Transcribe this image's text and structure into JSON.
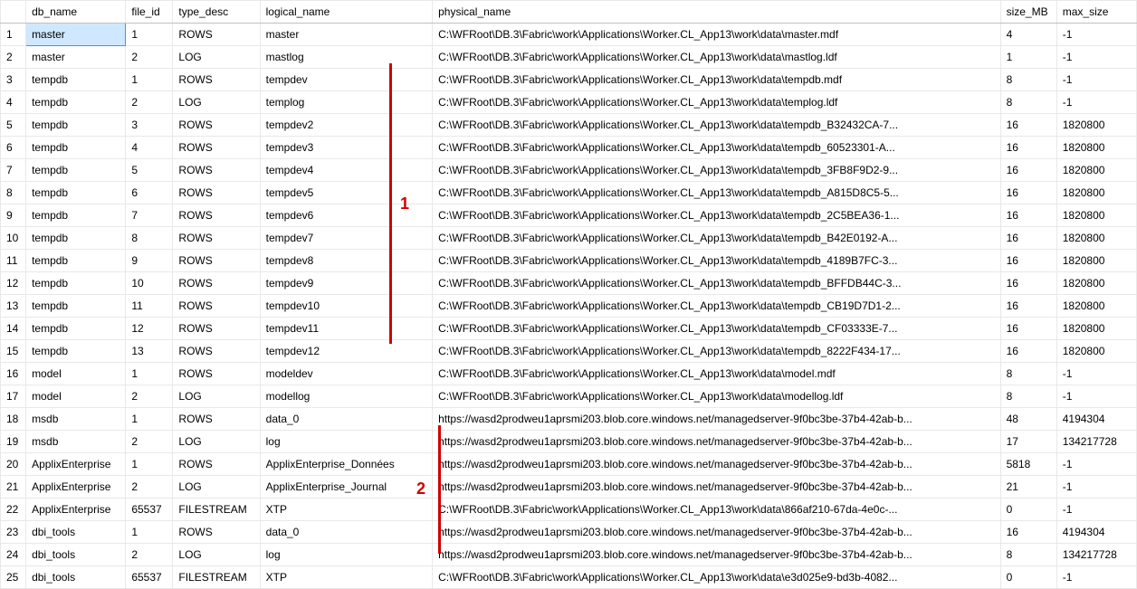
{
  "columns": [
    "db_name",
    "file_id",
    "type_desc",
    "logical_name",
    "physical_name",
    "size_MB",
    "max_size"
  ],
  "rows": [
    {
      "n": 1,
      "db_name": "master",
      "file_id": "1",
      "type_desc": "ROWS",
      "logical_name": "master",
      "physical_name": "C:\\WFRoot\\DB.3\\Fabric\\work\\Applications\\Worker.CL_App13\\work\\data\\master.mdf",
      "size_MB": "4",
      "max_size": "-1"
    },
    {
      "n": 2,
      "db_name": "master",
      "file_id": "2",
      "type_desc": "LOG",
      "logical_name": "mastlog",
      "physical_name": "C:\\WFRoot\\DB.3\\Fabric\\work\\Applications\\Worker.CL_App13\\work\\data\\mastlog.ldf",
      "size_MB": "1",
      "max_size": "-1"
    },
    {
      "n": 3,
      "db_name": "tempdb",
      "file_id": "1",
      "type_desc": "ROWS",
      "logical_name": "tempdev",
      "physical_name": "C:\\WFRoot\\DB.3\\Fabric\\work\\Applications\\Worker.CL_App13\\work\\data\\tempdb.mdf",
      "size_MB": "8",
      "max_size": "-1"
    },
    {
      "n": 4,
      "db_name": "tempdb",
      "file_id": "2",
      "type_desc": "LOG",
      "logical_name": "templog",
      "physical_name": "C:\\WFRoot\\DB.3\\Fabric\\work\\Applications\\Worker.CL_App13\\work\\data\\templog.ldf",
      "size_MB": "8",
      "max_size": "-1"
    },
    {
      "n": 5,
      "db_name": "tempdb",
      "file_id": "3",
      "type_desc": "ROWS",
      "logical_name": "tempdev2",
      "physical_name": "C:\\WFRoot\\DB.3\\Fabric\\work\\Applications\\Worker.CL_App13\\work\\data\\tempdb_B32432CA-7...",
      "size_MB": "16",
      "max_size": "1820800"
    },
    {
      "n": 6,
      "db_name": "tempdb",
      "file_id": "4",
      "type_desc": "ROWS",
      "logical_name": "tempdev3",
      "physical_name": "C:\\WFRoot\\DB.3\\Fabric\\work\\Applications\\Worker.CL_App13\\work\\data\\tempdb_60523301-A...",
      "size_MB": "16",
      "max_size": "1820800"
    },
    {
      "n": 7,
      "db_name": "tempdb",
      "file_id": "5",
      "type_desc": "ROWS",
      "logical_name": "tempdev4",
      "physical_name": "C:\\WFRoot\\DB.3\\Fabric\\work\\Applications\\Worker.CL_App13\\work\\data\\tempdb_3FB8F9D2-9...",
      "size_MB": "16",
      "max_size": "1820800"
    },
    {
      "n": 8,
      "db_name": "tempdb",
      "file_id": "6",
      "type_desc": "ROWS",
      "logical_name": "tempdev5",
      "physical_name": "C:\\WFRoot\\DB.3\\Fabric\\work\\Applications\\Worker.CL_App13\\work\\data\\tempdb_A815D8C5-5...",
      "size_MB": "16",
      "max_size": "1820800"
    },
    {
      "n": 9,
      "db_name": "tempdb",
      "file_id": "7",
      "type_desc": "ROWS",
      "logical_name": "tempdev6",
      "physical_name": "C:\\WFRoot\\DB.3\\Fabric\\work\\Applications\\Worker.CL_App13\\work\\data\\tempdb_2C5BEA36-1...",
      "size_MB": "16",
      "max_size": "1820800"
    },
    {
      "n": 10,
      "db_name": "tempdb",
      "file_id": "8",
      "type_desc": "ROWS",
      "logical_name": "tempdev7",
      "physical_name": "C:\\WFRoot\\DB.3\\Fabric\\work\\Applications\\Worker.CL_App13\\work\\data\\tempdb_B42E0192-A...",
      "size_MB": "16",
      "max_size": "1820800"
    },
    {
      "n": 11,
      "db_name": "tempdb",
      "file_id": "9",
      "type_desc": "ROWS",
      "logical_name": "tempdev8",
      "physical_name": "C:\\WFRoot\\DB.3\\Fabric\\work\\Applications\\Worker.CL_App13\\work\\data\\tempdb_4189B7FC-3...",
      "size_MB": "16",
      "max_size": "1820800"
    },
    {
      "n": 12,
      "db_name": "tempdb",
      "file_id": "10",
      "type_desc": "ROWS",
      "logical_name": "tempdev9",
      "physical_name": "C:\\WFRoot\\DB.3\\Fabric\\work\\Applications\\Worker.CL_App13\\work\\data\\tempdb_BFFDB44C-3...",
      "size_MB": "16",
      "max_size": "1820800"
    },
    {
      "n": 13,
      "db_name": "tempdb",
      "file_id": "11",
      "type_desc": "ROWS",
      "logical_name": "tempdev10",
      "physical_name": "C:\\WFRoot\\DB.3\\Fabric\\work\\Applications\\Worker.CL_App13\\work\\data\\tempdb_CB19D7D1-2...",
      "size_MB": "16",
      "max_size": "1820800"
    },
    {
      "n": 14,
      "db_name": "tempdb",
      "file_id": "12",
      "type_desc": "ROWS",
      "logical_name": "tempdev11",
      "physical_name": "C:\\WFRoot\\DB.3\\Fabric\\work\\Applications\\Worker.CL_App13\\work\\data\\tempdb_CF03333E-7...",
      "size_MB": "16",
      "max_size": "1820800"
    },
    {
      "n": 15,
      "db_name": "tempdb",
      "file_id": "13",
      "type_desc": "ROWS",
      "logical_name": "tempdev12",
      "physical_name": "C:\\WFRoot\\DB.3\\Fabric\\work\\Applications\\Worker.CL_App13\\work\\data\\tempdb_8222F434-17...",
      "size_MB": "16",
      "max_size": "1820800"
    },
    {
      "n": 16,
      "db_name": "model",
      "file_id": "1",
      "type_desc": "ROWS",
      "logical_name": "modeldev",
      "physical_name": "C:\\WFRoot\\DB.3\\Fabric\\work\\Applications\\Worker.CL_App13\\work\\data\\model.mdf",
      "size_MB": "8",
      "max_size": "-1"
    },
    {
      "n": 17,
      "db_name": "model",
      "file_id": "2",
      "type_desc": "LOG",
      "logical_name": "modellog",
      "physical_name": "C:\\WFRoot\\DB.3\\Fabric\\work\\Applications\\Worker.CL_App13\\work\\data\\modellog.ldf",
      "size_MB": "8",
      "max_size": "-1"
    },
    {
      "n": 18,
      "db_name": "msdb",
      "file_id": "1",
      "type_desc": "ROWS",
      "logical_name": "data_0",
      "physical_name": "https://wasd2prodweu1aprsmi203.blob.core.windows.net/managedserver-9f0bc3be-37b4-42ab-b...",
      "size_MB": "48",
      "max_size": "4194304"
    },
    {
      "n": 19,
      "db_name": "msdb",
      "file_id": "2",
      "type_desc": "LOG",
      "logical_name": "log",
      "physical_name": "https://wasd2prodweu1aprsmi203.blob.core.windows.net/managedserver-9f0bc3be-37b4-42ab-b...",
      "size_MB": "17",
      "max_size": "134217728"
    },
    {
      "n": 20,
      "db_name": "ApplixEnterprise",
      "file_id": "1",
      "type_desc": "ROWS",
      "logical_name": "ApplixEnterprise_Données",
      "physical_name": "https://wasd2prodweu1aprsmi203.blob.core.windows.net/managedserver-9f0bc3be-37b4-42ab-b...",
      "size_MB": "5818",
      "max_size": "-1"
    },
    {
      "n": 21,
      "db_name": "ApplixEnterprise",
      "file_id": "2",
      "type_desc": "LOG",
      "logical_name": "ApplixEnterprise_Journal",
      "physical_name": "https://wasd2prodweu1aprsmi203.blob.core.windows.net/managedserver-9f0bc3be-37b4-42ab-b...",
      "size_MB": "21",
      "max_size": "-1"
    },
    {
      "n": 22,
      "db_name": "ApplixEnterprise",
      "file_id": "65537",
      "type_desc": "FILESTREAM",
      "logical_name": "XTP",
      "physical_name": "C:\\WFRoot\\DB.3\\Fabric\\work\\Applications\\Worker.CL_App13\\work\\data\\866af210-67da-4e0c-...",
      "size_MB": "0",
      "max_size": "-1"
    },
    {
      "n": 23,
      "db_name": "dbi_tools",
      "file_id": "1",
      "type_desc": "ROWS",
      "logical_name": "data_0",
      "physical_name": "https://wasd2prodweu1aprsmi203.blob.core.windows.net/managedserver-9f0bc3be-37b4-42ab-b...",
      "size_MB": "16",
      "max_size": "4194304"
    },
    {
      "n": 24,
      "db_name": "dbi_tools",
      "file_id": "2",
      "type_desc": "LOG",
      "logical_name": "log",
      "physical_name": "https://wasd2prodweu1aprsmi203.blob.core.windows.net/managedserver-9f0bc3be-37b4-42ab-b...",
      "size_MB": "8",
      "max_size": "134217728"
    },
    {
      "n": 25,
      "db_name": "dbi_tools",
      "file_id": "65537",
      "type_desc": "FILESTREAM",
      "logical_name": "XTP",
      "physical_name": "C:\\WFRoot\\DB.3\\Fabric\\work\\Applications\\Worker.CL_App13\\work\\data\\e3d025e9-bd3b-4082...",
      "size_MB": "0",
      "max_size": "-1"
    }
  ],
  "annotations": {
    "a1": "1",
    "a2": "2"
  },
  "selected_cell": {
    "row": 1,
    "col": "db_name"
  }
}
